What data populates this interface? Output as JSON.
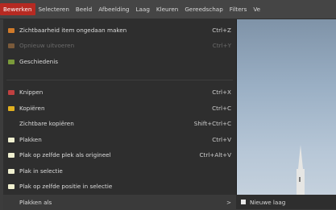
{
  "menubar": {
    "items": [
      "Bewerken",
      "Selecteren",
      "Beeld",
      "Afbeelding",
      "Laag",
      "Kleuren",
      "Gereedschap",
      "Filters",
      "Ve"
    ],
    "active_index": 0
  },
  "menu": {
    "items": [
      {
        "label": "Zichtbaarheid item ongedaan maken",
        "shortcut": "Ctrl+Z",
        "icon": "undo-icon",
        "icon_color": "#d07a2a",
        "disabled": false
      },
      {
        "label": "Opnieuw uitvoeren",
        "shortcut": "Ctrl+Y",
        "icon": "redo-icon",
        "icon_color": "#7a5a3a",
        "disabled": true
      },
      {
        "label": "Geschiedenis",
        "shortcut": "",
        "icon": "history-icon",
        "icon_color": "#7a9a3a",
        "disabled": false
      },
      {
        "label": "Knippen",
        "shortcut": "Ctrl+X",
        "icon": "scissors-icon",
        "icon_color": "#c04040",
        "disabled": false
      },
      {
        "label": "Kopiëren",
        "shortcut": "Ctrl+C",
        "icon": "copy-icon",
        "icon_color": "#e0b020",
        "disabled": false
      },
      {
        "label": "Zichtbare kopiëren",
        "shortcut": "Shift+Ctrl+C",
        "icon": "",
        "icon_color": "",
        "disabled": false
      },
      {
        "label": "Plakken",
        "shortcut": "Ctrl+V",
        "icon": "paste-icon",
        "icon_color": "#f0f0d0",
        "disabled": false
      },
      {
        "label": "Plak op zelfde plek als origineel",
        "shortcut": "Ctrl+Alt+V",
        "icon": "paste-icon",
        "icon_color": "#f0f0d0",
        "disabled": false
      },
      {
        "label": "Plak in selectie",
        "shortcut": "",
        "icon": "paste-icon",
        "icon_color": "#f0f0d0",
        "disabled": false
      },
      {
        "label": "Plak op zelfde positie in selectie",
        "shortcut": "",
        "icon": "paste-icon",
        "icon_color": "#f0f0d0",
        "disabled": false
      },
      {
        "label": "Plakken als",
        "shortcut": ">",
        "icon": "",
        "icon_color": "",
        "disabled": false
      }
    ]
  },
  "submenu": {
    "label": "Nieuwe laag"
  }
}
